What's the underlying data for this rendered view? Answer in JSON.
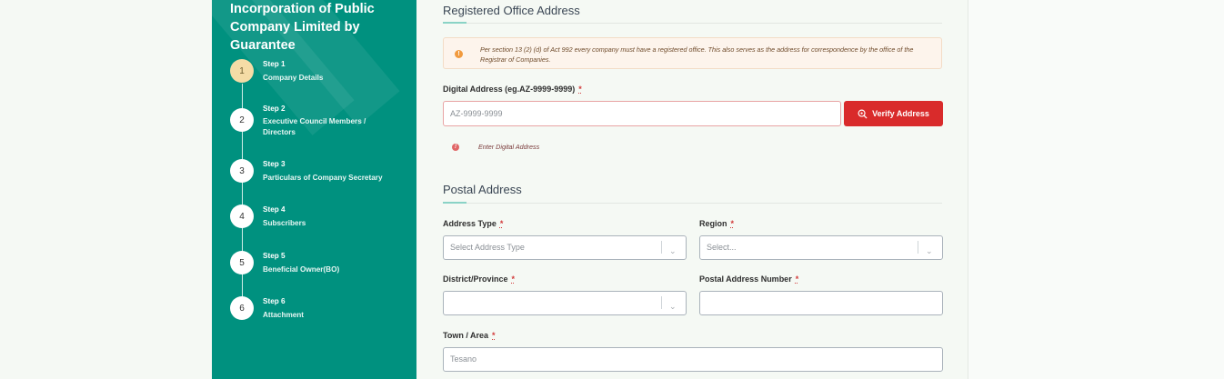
{
  "sidebar": {
    "title": "Incorporation of Public Company Limited by Guarantee",
    "steps": [
      {
        "number": "1",
        "step": "Step 1",
        "name": "Company Details",
        "active": true
      },
      {
        "number": "2",
        "step": "Step 2",
        "name": "Executive Council Members / Directors",
        "active": false
      },
      {
        "number": "3",
        "step": "Step 3",
        "name": "Particulars of Company Secretary",
        "active": false
      },
      {
        "number": "4",
        "step": "Step 4",
        "name": "Subscribers",
        "active": false
      },
      {
        "number": "5",
        "step": "Step 5",
        "name": "Beneficial Owner(BO)",
        "active": false
      },
      {
        "number": "6",
        "step": "Step 6",
        "name": "Attachment",
        "active": false
      }
    ]
  },
  "registered": {
    "title": "Registered Office Address",
    "notice": "Per section 13 (2) (d) of Act 992 every company must have a registered office. This also serves as the address for correspondence by the office of the Registrar of Companies.",
    "digital_label": "Digital Address (eg.AZ-9999-9999)",
    "required_mark": "*",
    "digital_placeholder": "AZ-9999-9999",
    "verify_label": "Verify Address",
    "error_text": "Enter Digital Address"
  },
  "postal": {
    "title": "Postal Address",
    "address_type_label": "Address Type",
    "address_type_placeholder": "Select Address Type",
    "region_label": "Region",
    "region_placeholder": "Select...",
    "district_label": "District/Province",
    "district_value": "",
    "postal_number_label": "Postal Address Number",
    "postal_number_value": "",
    "town_label": "Town / Area",
    "town_value": "Tesano"
  },
  "colors": {
    "sidebar": "#00917f",
    "active_step": "#f5dca6",
    "verify_button": "#d92b2b",
    "required": "#d23a3a"
  }
}
